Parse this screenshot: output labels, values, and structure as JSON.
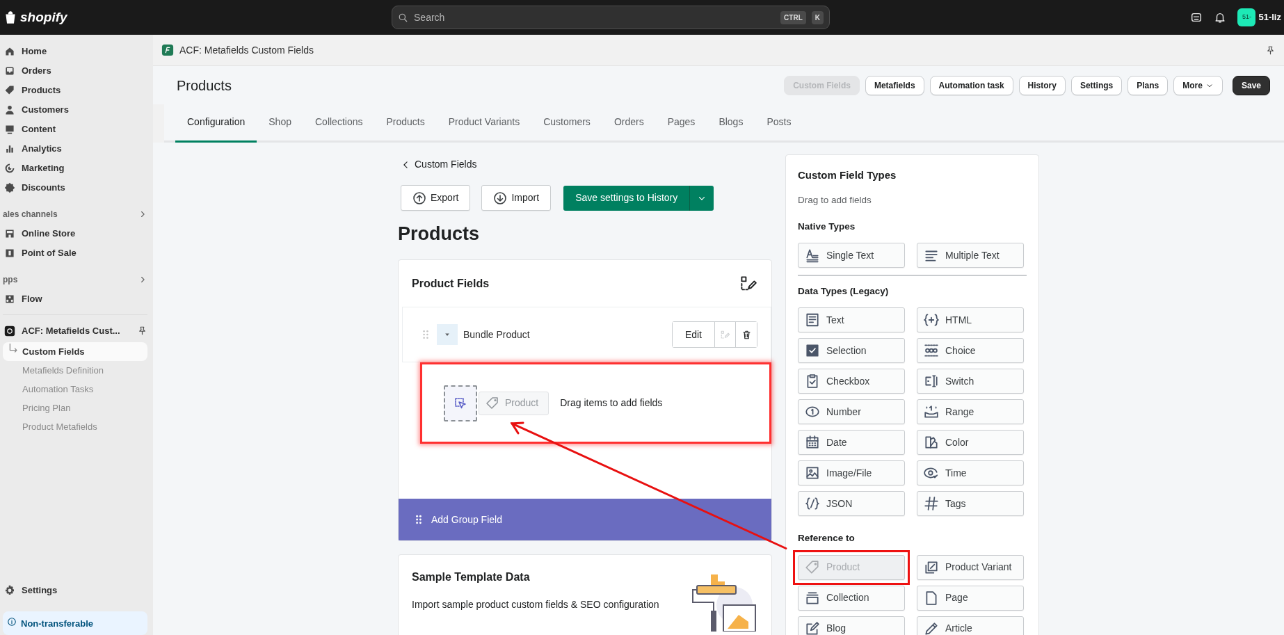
{
  "topbar": {
    "logo": "shopify",
    "search": {
      "placeholder": "Search",
      "shortcut": [
        "CTRL",
        "K"
      ]
    },
    "avatar": "51-",
    "store_name": "51-liz"
  },
  "sidebar": {
    "items": [
      {
        "kind": "nav",
        "label": "Home",
        "selected": false
      },
      {
        "kind": "nav",
        "label": "Orders",
        "selected": false
      },
      {
        "kind": "nav",
        "label": "Products",
        "selected": false
      },
      {
        "kind": "nav",
        "label": "Customers",
        "selected": false
      },
      {
        "kind": "nav",
        "label": "Content",
        "selected": false
      },
      {
        "kind": "nav",
        "label": "Analytics",
        "selected": false
      },
      {
        "kind": "nav",
        "label": "Marketing",
        "selected": false
      },
      {
        "kind": "nav",
        "label": "Discounts",
        "selected": false
      },
      {
        "kind": "heading",
        "label": "ales channels"
      },
      {
        "kind": "nav",
        "label": "Online Store",
        "selected": false
      },
      {
        "kind": "nav",
        "label": "Point of Sale",
        "selected": false
      },
      {
        "kind": "heading",
        "label": "pps"
      },
      {
        "kind": "nav",
        "label": "Flow",
        "selected": false
      },
      {
        "kind": "app",
        "label": "ACF: Metafields Cust..."
      },
      {
        "kind": "sub",
        "label": "Custom Fields",
        "selected": true
      },
      {
        "kind": "sub",
        "label": "Metafields Definition",
        "selected": false
      },
      {
        "kind": "sub",
        "label": "Automation Tasks",
        "selected": false
      },
      {
        "kind": "sub",
        "label": "Pricing Plan",
        "selected": false
      },
      {
        "kind": "sub",
        "label": "Product Metafields",
        "selected": false
      }
    ],
    "footer": [
      {
        "kind": "nav",
        "label": "Settings",
        "selected": false
      },
      {
        "kind": "notice",
        "label": "Non-transferable"
      }
    ]
  },
  "app_bar": {
    "title": "ACF: Metafields Custom Fields"
  },
  "page_header": {
    "title": "Products",
    "actions": [
      {
        "label": "Custom Fields",
        "kind": "plain",
        "disabled": true
      },
      {
        "label": "Metafields",
        "kind": "plain",
        "disabled": false
      },
      {
        "label": "Automation task",
        "kind": "plain",
        "disabled": false
      },
      {
        "label": "History",
        "kind": "plain",
        "disabled": false
      },
      {
        "label": "Settings",
        "kind": "plain",
        "disabled": false
      },
      {
        "label": "Plans",
        "kind": "plain",
        "disabled": false
      },
      {
        "label": "More",
        "kind": "menu",
        "disabled": false
      },
      {
        "label": "Save",
        "kind": "primary",
        "disabled": false
      }
    ]
  },
  "tabs": [
    {
      "label": "Configuration",
      "selected": true
    },
    {
      "label": "Shop",
      "selected": false
    },
    {
      "label": "Collections",
      "selected": false
    },
    {
      "label": "Products",
      "selected": false
    },
    {
      "label": "Product Variants",
      "selected": false
    },
    {
      "label": "Customers",
      "selected": false
    },
    {
      "label": "Orders",
      "selected": false
    },
    {
      "label": "Pages",
      "selected": false
    },
    {
      "label": "Blogs",
      "selected": false
    },
    {
      "label": "Posts",
      "selected": false
    }
  ],
  "main": {
    "back_link": "Custom Fields",
    "toolbar": [
      {
        "label": "Export",
        "kind": "export"
      },
      {
        "label": "Import",
        "kind": "import"
      },
      {
        "label": "Save settings to History",
        "kind": "split-primary"
      }
    ],
    "heading": "Products",
    "fields_card": {
      "title": "Product Fields",
      "fields": [
        {
          "label": "Bundle Product",
          "edit": "Edit"
        }
      ],
      "drop_zone": {
        "text": "Drag items to add fields",
        "dragged_item": "Product",
        "highlighted": true
      },
      "add_group": "Add Group Field"
    },
    "sample_card": {
      "title": "Sample Template Data",
      "description": "Import sample product custom fields & SEO configuration"
    }
  },
  "field_types": {
    "title": "Custom Field Types",
    "subtitle": "Drag to add fields",
    "groups": [
      {
        "title": "Native Types",
        "items": [
          {
            "label": "Single Text",
            "disabled": false,
            "highlighted": false
          },
          {
            "label": "Multiple Text",
            "disabled": false,
            "highlighted": false
          }
        ]
      },
      {
        "title": "Data Types (Legacy)",
        "items": [
          {
            "label": "Text",
            "disabled": false,
            "highlighted": false
          },
          {
            "label": "HTML",
            "disabled": false,
            "highlighted": false
          },
          {
            "label": "Selection",
            "disabled": false,
            "highlighted": false
          },
          {
            "label": "Choice",
            "disabled": false,
            "highlighted": false
          },
          {
            "label": "Checkbox",
            "disabled": false,
            "highlighted": false
          },
          {
            "label": "Switch",
            "disabled": false,
            "highlighted": false
          },
          {
            "label": "Number",
            "disabled": false,
            "highlighted": false
          },
          {
            "label": "Range",
            "disabled": false,
            "highlighted": false
          },
          {
            "label": "Date",
            "disabled": false,
            "highlighted": false
          },
          {
            "label": "Color",
            "disabled": false,
            "highlighted": false
          },
          {
            "label": "Image/File",
            "disabled": false,
            "highlighted": false
          },
          {
            "label": "Time",
            "disabled": false,
            "highlighted": false
          },
          {
            "label": "JSON",
            "disabled": false,
            "highlighted": false
          },
          {
            "label": "Tags",
            "disabled": false,
            "highlighted": false
          }
        ]
      },
      {
        "title": "Reference to",
        "items": [
          {
            "label": "Product",
            "disabled": true,
            "highlighted": true
          },
          {
            "label": "Product Variant",
            "disabled": false,
            "highlighted": false
          },
          {
            "label": "Collection",
            "disabled": false,
            "highlighted": false
          },
          {
            "label": "Page",
            "disabled": false,
            "highlighted": false
          },
          {
            "label": "Blog",
            "disabled": false,
            "highlighted": false
          },
          {
            "label": "Article",
            "disabled": false,
            "highlighted": false
          }
        ]
      }
    ]
  }
}
